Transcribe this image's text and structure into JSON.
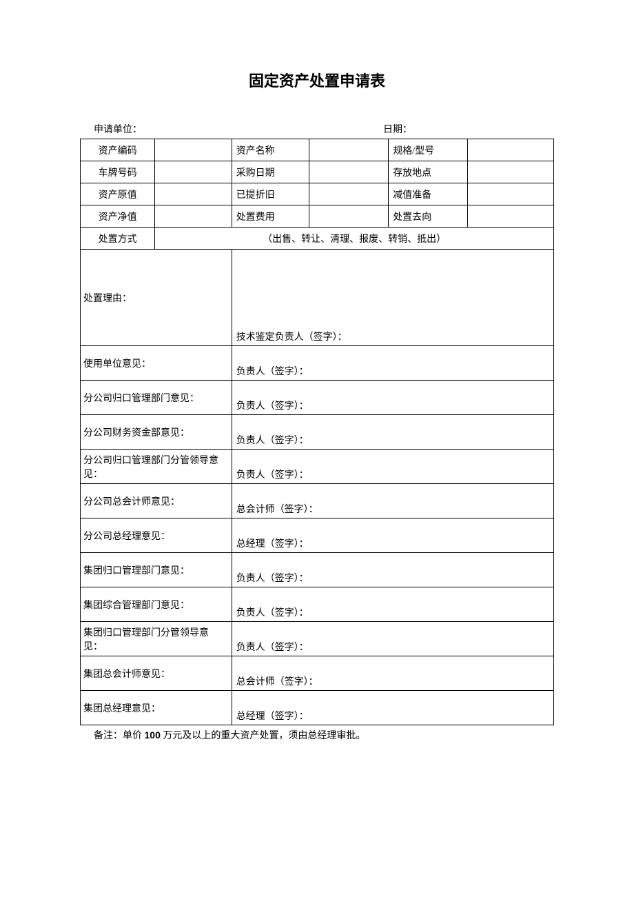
{
  "title": "固定资产处置申请表",
  "header": {
    "unit_label": "申请单位：",
    "date_label": "日期："
  },
  "r1": {
    "a": "资产编码",
    "b": "资产名称",
    "c": "规格/型号"
  },
  "r2": {
    "a": "车牌号码",
    "b": "采购日期",
    "c": "存放地点"
  },
  "r3": {
    "a": "资产原值",
    "b": "已提折旧",
    "c": "减值准备"
  },
  "r4": {
    "a": "资产净值",
    "b": "处置费用",
    "c": "处置去向"
  },
  "r5": {
    "a": "处置方式",
    "methods": "（出售、转让、清理、报废、转销、抵出）"
  },
  "reason": {
    "label": "处置理由：",
    "sig": "技术鉴定负责人（签字）："
  },
  "opinions": [
    {
      "label": "使用单位意见：",
      "sig": "负责人（签字）："
    },
    {
      "label": "分公司归口管理部门意见：",
      "sig": "负责人（签字）："
    },
    {
      "label": "分公司财务资金部意见：",
      "sig": "负责人（签字）："
    },
    {
      "label": "分公司归口管理部门分管领导意见：",
      "sig": "负责人（签字）："
    },
    {
      "label": "分公司总会计师意见：",
      "sig": "总会计师（签字）："
    },
    {
      "label": "分公司总经理意见：",
      "sig": "总经理（签字）："
    },
    {
      "label": "集团归口管理部门意见：",
      "sig": "负责人（签字）："
    },
    {
      "label": "集团综合管理部门意见：",
      "sig": "负责人（签字）："
    },
    {
      "label": "集团归口管理部门分管领导意见：",
      "sig": "负责人（签字）："
    },
    {
      "label": "集团总会计师意见：",
      "sig": "总会计师（签字）："
    },
    {
      "label": "集团总经理意见：",
      "sig": "总经理（签字）："
    }
  ],
  "note": {
    "prefix": "备注：单价 ",
    "amount": "100",
    "suffix": " 万元及以上的重大资产处置，须由总经理审批。"
  }
}
